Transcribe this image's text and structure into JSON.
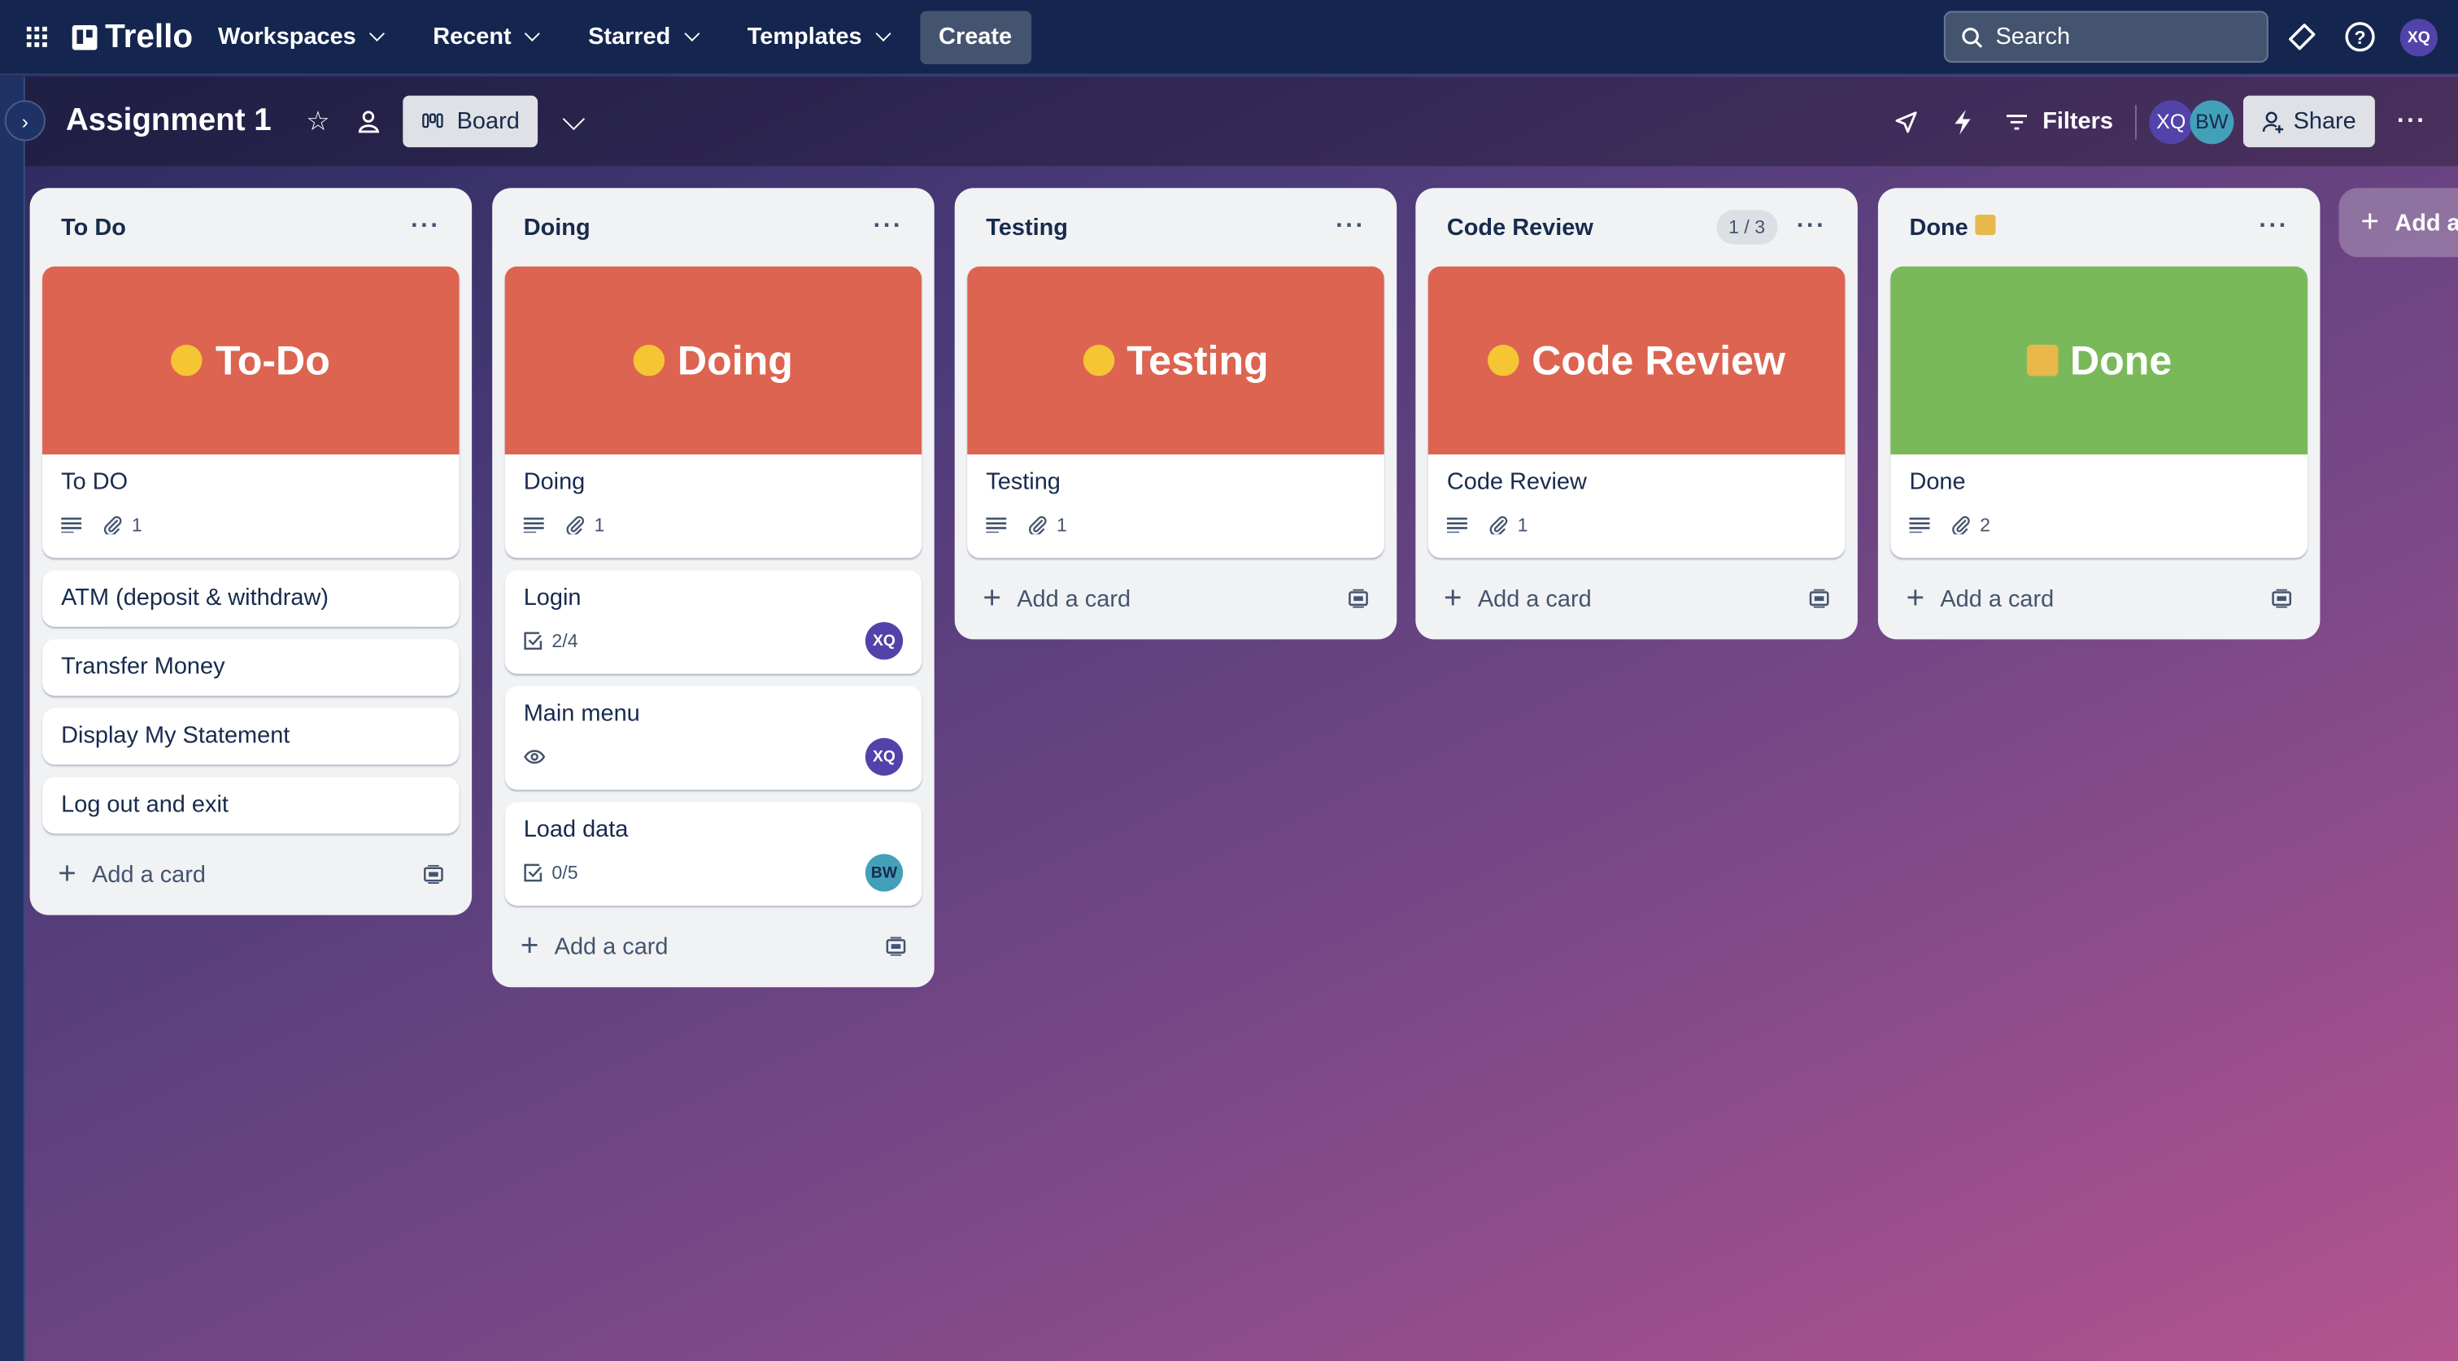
{
  "topbar": {
    "logo": "Trello",
    "nav": [
      "Workspaces",
      "Recent",
      "Starred",
      "Templates"
    ],
    "create_label": "Create",
    "search_placeholder": "Search",
    "user_initials": "XQ"
  },
  "board": {
    "title": "Assignment 1",
    "view_label": "Board",
    "filters_label": "Filters",
    "share_label": "Share",
    "members": [
      {
        "initials": "XQ",
        "color": "#5243aa"
      },
      {
        "initials": "BW",
        "color": "#43a0b9"
      }
    ]
  },
  "colors": {
    "cover_red": "#dc6450",
    "cover_green": "#79b95a",
    "avatar_xq": "#5243aa",
    "avatar_bw": "#43a0b9"
  },
  "add_card_label": "Add a card",
  "add_list_label": "Add another list",
  "lists": [
    {
      "title": "To Do",
      "badge": "",
      "cards": [
        {
          "cover_text": "To-Do",
          "cover_color": "#dc6450",
          "cover_icon": "thinking-face-icon",
          "title": "To DO",
          "description": true,
          "attachments": "1"
        },
        {
          "title": "ATM (deposit & withdraw)"
        },
        {
          "title": "Transfer Money"
        },
        {
          "title": "Display My Statement"
        },
        {
          "title": "Log out and exit"
        }
      ]
    },
    {
      "title": "Doing",
      "badge": "",
      "cards": [
        {
          "cover_text": "Doing",
          "cover_color": "#dc6450",
          "cover_icon": "nerd-face-icon",
          "title": "Doing",
          "description": true,
          "attachments": "1"
        },
        {
          "title": "Login",
          "checklist": "2/4",
          "member": "XQ"
        },
        {
          "title": "Main menu",
          "watching": true,
          "member": "XQ"
        },
        {
          "title": "Load data",
          "checklist": "0/5",
          "member": "BW"
        }
      ]
    },
    {
      "title": "Testing",
      "badge": "",
      "cards": [
        {
          "cover_text": "Testing",
          "cover_color": "#dc6450",
          "cover_icon": "crossed-fingers-icon",
          "title": "Testing",
          "description": true,
          "attachments": "1"
        }
      ]
    },
    {
      "title": "Code Review",
      "badge": "1 / 3",
      "cards": [
        {
          "cover_text": "Code Review",
          "cover_color": "#dc6450",
          "cover_icon": "grimacing-face-icon",
          "title": "Code Review",
          "description": true,
          "attachments": "1"
        }
      ]
    },
    {
      "title": "Done",
      "title_icon": "party-popper-icon",
      "badge": "",
      "cards": [
        {
          "cover_text": "Done",
          "cover_color": "#79b95a",
          "cover_icon": "party-popper-icon",
          "title": "Done",
          "description": true,
          "attachments": "2"
        }
      ]
    }
  ]
}
